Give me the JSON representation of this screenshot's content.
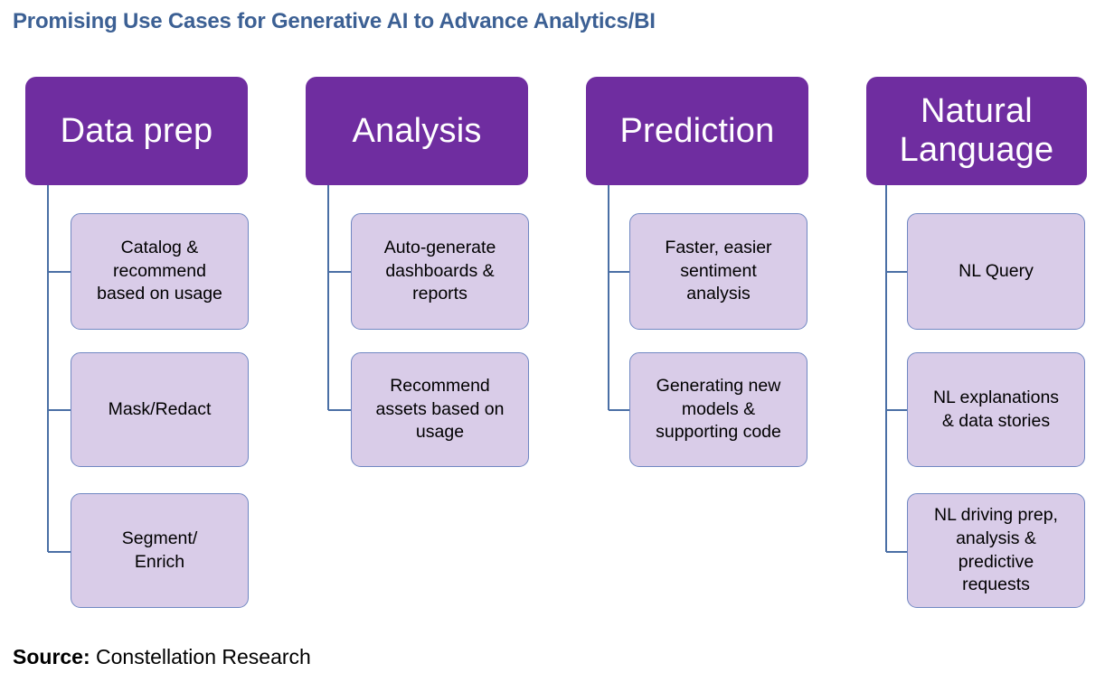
{
  "title": "Promising Use Cases for Generative AI to Advance Analytics/BI",
  "source": {
    "label": "Source:",
    "value": "Constellation Research"
  },
  "colors": {
    "title_blue": "#3c6094",
    "header_purple": "#6f2da0",
    "child_lavender": "#d9cce8",
    "child_border_blue": "#7087c2",
    "connector_blue": "#4a6fa5",
    "text_black": "#000000",
    "header_text": "#ffffff",
    "background": "#ffffff"
  },
  "diagram": {
    "type": "hierarchy-tree",
    "columns": [
      {
        "header": "Data prep",
        "children": [
          "Catalog &\nrecommend\nbased on usage",
          "Mask/Redact",
          "Segment/\nEnrich"
        ]
      },
      {
        "header": "Analysis",
        "children": [
          "Auto-generate\ndashboards &\nreports",
          "Recommend\nassets based on\nusage"
        ]
      },
      {
        "header": "Prediction",
        "children": [
          "Faster, easier\nsentiment\nanalysis",
          "Generating new\nmodels &\nsupporting code"
        ]
      },
      {
        "header": "Natural\nLanguage",
        "children": [
          "NL Query",
          "NL explanations\n& data stories",
          "NL driving prep,\nanalysis &\npredictive\nrequests"
        ]
      }
    ]
  }
}
